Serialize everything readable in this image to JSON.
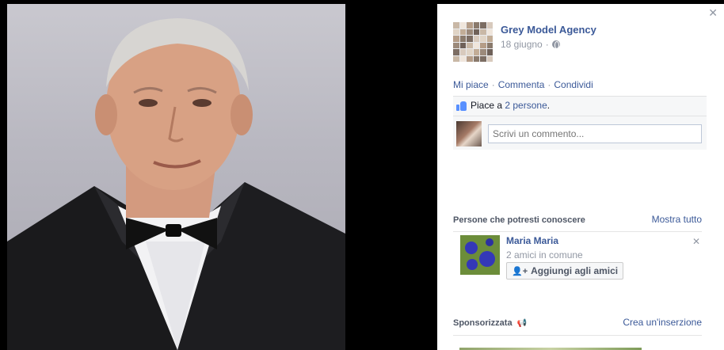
{
  "post": {
    "page_name": "Grey Model Agency",
    "date": "18 giugno",
    "separator": "·"
  },
  "actions": {
    "like": "Mi piace",
    "comment": "Commenta",
    "share": "Condividi",
    "separator": "·"
  },
  "likes": {
    "prefix": "Piace a",
    "count_link": "2 persone",
    "suffix": "."
  },
  "comment": {
    "placeholder": "Scrivi un commento..."
  },
  "pymk": {
    "title": "Persone che potresti conoscere",
    "see_all": "Mostra tutto",
    "person": {
      "name": "Maria Maria",
      "mutual": "2 amici in comune",
      "add_button": "Aggiungi agli amici"
    }
  },
  "sponsored": {
    "title": "Sponsorizzata",
    "create_ad": "Crea un'inserzione"
  },
  "icons": {
    "close": "close-icon",
    "globe": "globe-icon",
    "like": "thumbs-up-icon",
    "add_friend": "add-friend-icon",
    "megaphone": "megaphone-icon"
  },
  "colors": {
    "link": "#3b5998",
    "meta": "#9197a3",
    "background": "#000000",
    "panel": "#ffffff"
  }
}
